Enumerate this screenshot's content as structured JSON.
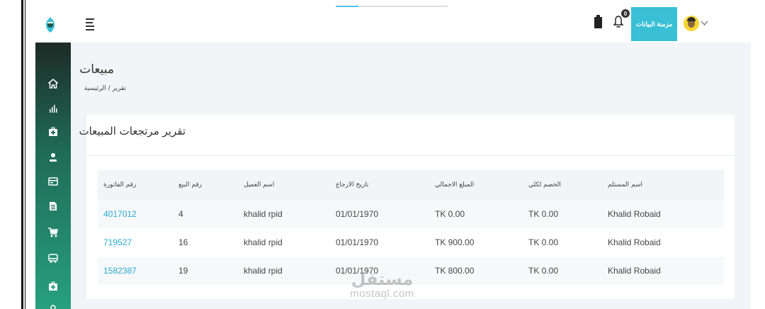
{
  "header": {
    "sync_button_label": "مزمنة البيانات",
    "notification_count": "0"
  },
  "page": {
    "title": "مبيعات",
    "breadcrumb": [
      {
        "label": "تقرير"
      },
      {
        "label": "/"
      },
      {
        "label": "الرئيسية"
      }
    ]
  },
  "sidebar": {
    "items": [
      {
        "icon": "home-icon"
      },
      {
        "icon": "bar-chart-icon"
      },
      {
        "icon": "first-aid-kit-icon"
      },
      {
        "icon": "user-icon"
      },
      {
        "icon": "card-icon"
      },
      {
        "icon": "document-icon"
      },
      {
        "icon": "cart-icon"
      },
      {
        "icon": "truck-icon"
      },
      {
        "icon": "first-aid-kit-icon"
      },
      {
        "icon": "more-icon"
      }
    ]
  },
  "report": {
    "title": "تقرير مرتجعات المبيعات",
    "columns": [
      "رقم الفاتورة",
      "رقم البيع",
      "اسم العميل",
      "تاريخ الارجاع",
      "المبلغ الاجمالي",
      "الخصم لكلي",
      "اسم المستلم"
    ],
    "rows": [
      {
        "invoice": "4017012",
        "sale": "4",
        "customer": "khalid rpid",
        "return_date": "01/01/1970",
        "total": "TK 0.00",
        "discount": "TK 0.00",
        "receiver": "Khalid Robaid"
      },
      {
        "invoice": "719527",
        "sale": "16",
        "customer": "khalid rpid",
        "return_date": "01/01/1970",
        "total": "TK 900.00",
        "discount": "TK 0.00",
        "receiver": "Khalid Robaid"
      },
      {
        "invoice": "1582387",
        "sale": "19",
        "customer": "khalid rpid",
        "return_date": "01/01/1970",
        "total": "TK 800.00",
        "discount": "TK 0.00",
        "receiver": "Khalid Robaid"
      }
    ]
  },
  "watermark": {
    "arabic": "مستقل",
    "latin": "mostaql.com"
  },
  "colors": {
    "accent": "#39bfd6",
    "link": "#29a9d1",
    "sidebar_top": "#1d2b26",
    "sidebar_bottom": "#27a07e"
  }
}
